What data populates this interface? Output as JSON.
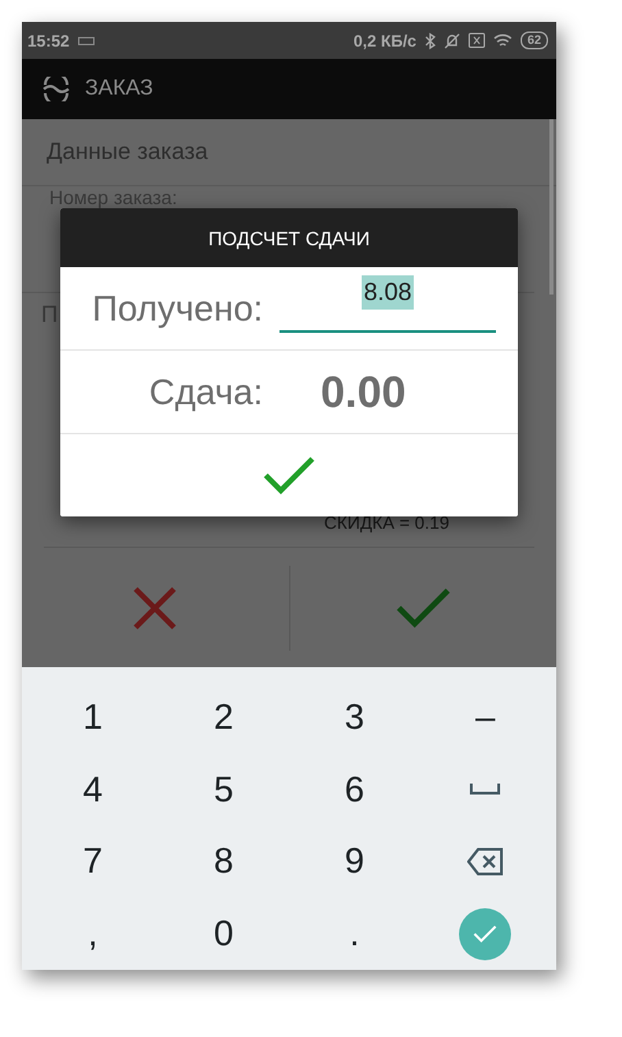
{
  "status_bar": {
    "time": "15:52",
    "speed": "0,2 КБ/с",
    "battery": "62"
  },
  "app_bar": {
    "title": "ЗАКАЗ"
  },
  "screen": {
    "section_title": "Данные заказа",
    "order_label": "Номер заказа:",
    "field_label_start": "П",
    "discount": "СКИДКА = 0.19"
  },
  "dialog": {
    "title": "ПОДСЧЕТ СДАЧИ",
    "received_label": "Получено:",
    "received_value": "8.08",
    "change_label": "Сдача:",
    "change_value": "0.00"
  },
  "keyboard": {
    "keys": [
      {
        "kind": "char",
        "label": "1"
      },
      {
        "kind": "char",
        "label": "2"
      },
      {
        "kind": "char",
        "label": "3"
      },
      {
        "kind": "char",
        "label": "–"
      },
      {
        "kind": "char",
        "label": "4"
      },
      {
        "kind": "char",
        "label": "5"
      },
      {
        "kind": "char",
        "label": "6"
      },
      {
        "kind": "space"
      },
      {
        "kind": "char",
        "label": "7"
      },
      {
        "kind": "char",
        "label": "8"
      },
      {
        "kind": "char",
        "label": "9"
      },
      {
        "kind": "backspace"
      },
      {
        "kind": "char",
        "label": ","
      },
      {
        "kind": "char",
        "label": "0"
      },
      {
        "kind": "char",
        "label": "."
      },
      {
        "kind": "enter"
      }
    ]
  }
}
